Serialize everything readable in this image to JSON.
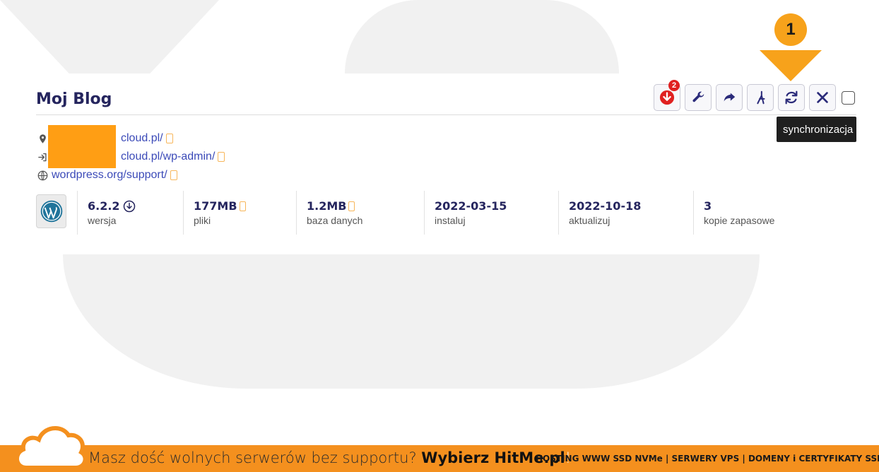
{
  "site": {
    "title": "Moj Blog",
    "links": [
      {
        "icon": "location-pin-icon",
        "text": "cloud.pl/"
      },
      {
        "icon": "login-icon",
        "text": "cloud.pl/wp-admin/"
      },
      {
        "icon": "globe-icon",
        "text": "wordpress.org/support/"
      }
    ]
  },
  "toolbar": {
    "update_badge": "2",
    "tooltip": "synchronizacja"
  },
  "annotation": {
    "step_number": "1",
    "accent_color": "#f7a21b"
  },
  "stats": [
    {
      "value": "6.2.2",
      "label": "wersja"
    },
    {
      "value": "177MB",
      "label": "pliki"
    },
    {
      "value": "1.2MB",
      "label": "baza danych"
    },
    {
      "value": "2022-03-15",
      "label": "instaluj"
    },
    {
      "value": "2022-10-18",
      "label": "aktualizuj"
    },
    {
      "value": "3",
      "label": "kopie zapasowe"
    }
  ],
  "footer": {
    "promo_text": "Masz dość wolnych serwerów bez supportu?",
    "promo_brand": "Wybierz HitMe.pl",
    "promo_end": "!",
    "services": "HOSTING WWW SSD NVMe | SERWERY VPS | DOMENY i CERTYFIKATY SSL",
    "color": "#f4901e"
  }
}
